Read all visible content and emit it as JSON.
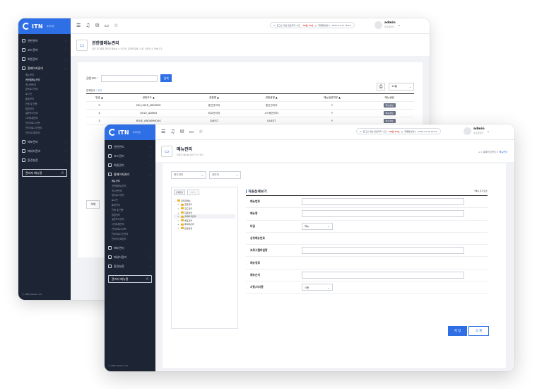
{
  "app": {
    "logo": "ITN",
    "logo_sub": "아이티엔"
  },
  "back": {
    "nav": [
      {
        "label": "권한관리",
        "icon": "shield-icon"
      },
      {
        "label": "코드관리",
        "icon": "document-icon"
      },
      {
        "label": "회원관리",
        "icon": "user-icon"
      },
      {
        "label": "홈페이지관리",
        "icon": "window-icon"
      }
    ],
    "subnav": [
      "메뉴관리",
      "권한별메뉴관리",
      "게시판관리",
      "접속로그관리",
      "로그인",
      "통계관리",
      "연계 및 연동",
      "팝업관리",
      "설문조사관리",
      "사이트맵관리",
      "관리자로그이력",
      "관리자로그인관리",
      "관리자기록관리"
    ],
    "bottom_nav": [
      {
        "label": "배포관리",
        "icon": "chart-icon"
      },
      {
        "label": "메세지관리",
        "icon": "message-icon"
      },
      {
        "label": "환경설정",
        "icon": "gear-icon"
      }
    ],
    "admin_menu_btn": "관리자 메뉴얼",
    "version": "ⓒ CMS Version 1.0",
    "session_prefix": "로그인 세션 만료까지 시간 :",
    "session_time": "59분 13초",
    "last_login": "최종접속일시 : 2021.01.22 16:45",
    "user": {
      "name": "admin",
      "role": "최고관리자"
    },
    "page_title": "권한별메뉴관리",
    "page_desc": "권한 코드별로 관리자 메뉴를 수 있으며, 권한을 등록, 수정, 삭제할 수 있습니다.",
    "search_label": "권한코드 :",
    "search_btn": "검색",
    "total_label": "전체건수 :",
    "total_count": "5건",
    "page_size": "10줄",
    "columns": [
      "번호 ▲",
      "권한코드 ▲",
      "권한명 ▲",
      "권한설명 ▲",
      "메뉴생성여부 ▲",
      "메뉴생성"
    ],
    "rows": [
      {
        "no": "5",
        "code": "MD_USER_MEMBER",
        "name": "중간관리자",
        "desc": "중간관리자",
        "yn": "Y",
        "btn": "메뉴생성"
      },
      {
        "no": "4",
        "code": "ROLE_ADMIN",
        "name": "최고관리자",
        "desc": "시스템관리자",
        "yn": "Y",
        "btn": "메뉴생성"
      },
      {
        "no": "3",
        "code": "ROLE_ANONYMOUS",
        "name": "GUEST",
        "desc": "GUEST",
        "yn": "Y",
        "btn": "메뉴생성"
      }
    ],
    "delete_btn": "삭제"
  },
  "front": {
    "nav": [
      {
        "label": "권한관리",
        "icon": "shield-icon"
      },
      {
        "label": "코드관리",
        "icon": "document-icon"
      },
      {
        "label": "회원관리",
        "icon": "user-icon"
      },
      {
        "label": "홈페이지관리",
        "icon": "window-icon"
      }
    ],
    "subnav": [
      "메뉴관리",
      "권한별메뉴관리",
      "게시판관리",
      "접속로그관리",
      "로그인",
      "통계관리",
      "연계 및 연동",
      "팝업관리",
      "설문조사관리",
      "사이트맵관리",
      "관리자로그이력",
      "관리자로그인관리",
      "관리자기록관리"
    ],
    "bottom_nav": [
      {
        "label": "배포관리",
        "icon": "chart-icon"
      },
      {
        "label": "메세지관리",
        "icon": "message-icon"
      },
      {
        "label": "환경설정",
        "icon": "gear-icon"
      }
    ],
    "admin_menu_btn": "관리자 메뉴얼",
    "version": "ⓒ CMS Version 1.0",
    "session_prefix": "로그인 세션 만료까지 시간 :",
    "session_time": "59분 13초",
    "last_login": "최종접속일시 : 2021.01.22 16:45",
    "user": {
      "name": "admin",
      "role": "최고관리자"
    },
    "page_title": "메뉴관리",
    "page_desc": "관리자 메뉴를 관리 할 수 있다.",
    "breadcrumb": {
      "prefix": "⌂ > 홈페이지관리 >",
      "current": "메뉴관리"
    },
    "filter1": "최고관리",
    "filter2": "관리자",
    "tree_btn_open": "전체열기",
    "tree_btn_close": "전체닫기",
    "tree_root": "관리자메뉴",
    "tree_nodes": [
      "권한관리",
      "코드관리",
      "회원관리",
      "홈페이지관리",
      "배포관리",
      "메세지관리",
      "환경설정"
    ],
    "detail_title": "직원상세보기",
    "required_note": "메뉴 추가요소",
    "fields": [
      {
        "label": "메뉴번호",
        "kind": "input"
      },
      {
        "label": "메뉴명",
        "kind": "input"
      },
      {
        "label": "타입",
        "kind": "select",
        "value": "메뉴"
      },
      {
        "label": "상위메뉴번호",
        "kind": "none"
      },
      {
        "label": "프로그램파일명",
        "kind": "input"
      },
      {
        "label": "메뉴경로",
        "kind": "none"
      },
      {
        "label": "메뉴순서",
        "kind": "input"
      },
      {
        "label": "사용/미사용",
        "kind": "select",
        "value": "사용"
      }
    ],
    "save_btn": "저 장",
    "delete_btn": "삭 제"
  }
}
